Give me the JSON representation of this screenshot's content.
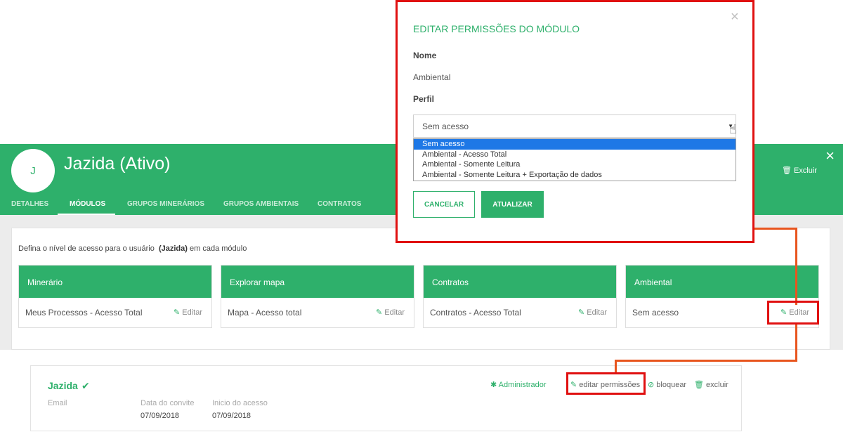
{
  "header": {
    "avatar_letter": "J",
    "user_title": "Jazida (Ativo)",
    "excluir_label": "Excluir",
    "close_symbol": "×",
    "tabs": [
      {
        "label": "DETALHES",
        "active": false
      },
      {
        "label": "MÓDULOS",
        "active": true
      },
      {
        "label": "GRUPOS MINERÁRIOS",
        "active": false
      },
      {
        "label": "GRUPOS AMBIENTAIS",
        "active": false
      },
      {
        "label": "CONTRATOS",
        "active": false
      }
    ]
  },
  "intro": {
    "prefix": "Defina o nível de acesso para o usuário ",
    "user": "(Jazida)",
    "suffix": " em cada módulo"
  },
  "modules": [
    {
      "title": "Minerário",
      "value": "Meus Processos - Acesso Total",
      "edit_label": "Editar"
    },
    {
      "title": "Explorar mapa",
      "value": "Mapa - Acesso total",
      "edit_label": "Editar"
    },
    {
      "title": "Contratos",
      "value": "Contratos - Acesso Total",
      "edit_label": "Editar"
    },
    {
      "title": "Ambiental",
      "value": "Sem acesso",
      "edit_label": "Editar"
    }
  ],
  "user_card": {
    "name": "Jazida",
    "email_label": "Email",
    "invite_label": "Data do convite",
    "invite_date": "07/09/2018",
    "access_label": "Inicio do acesso",
    "access_date": "07/09/2018",
    "role_label": "Administrador",
    "edit_permissions_label": "editar permissões",
    "block_label": "bloquear",
    "delete_label": "excluir"
  },
  "modal": {
    "title": "EDITAR PERMISSÕES DO MÓDULO",
    "name_label": "Nome",
    "name_value": "Ambiental",
    "profile_label": "Perfil",
    "selected": "Sem acesso",
    "options": [
      "Sem acesso",
      "Ambiental - Acesso Total",
      "Ambiental - Somente Leitura",
      "Ambiental - Somente Leitura + Exportação de dados"
    ],
    "cancel_label": "CANCELAR",
    "update_label": "ATUALIZAR",
    "close_symbol": "×"
  },
  "colors": {
    "brand_green": "#2eb06b",
    "highlight_red": "#e01010",
    "connector_orange": "#e8551e",
    "selected_blue": "#1e78e6"
  }
}
